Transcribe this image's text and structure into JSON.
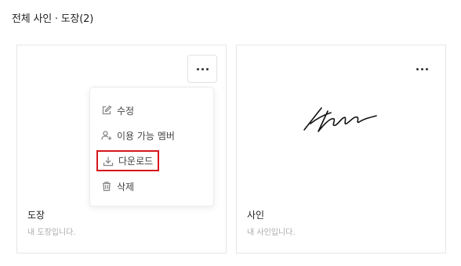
{
  "page": {
    "title": "전체 사인 · 도장(2)"
  },
  "cards": [
    {
      "name": "도장",
      "description": "내 도장입니다."
    },
    {
      "name": "사인",
      "description": "내 사인입니다."
    }
  ],
  "menu": {
    "edit": "수정",
    "members": "이용 가능 멤버",
    "download": "다운로드",
    "delete": "삭제"
  },
  "colors": {
    "highlight": "#d6151c",
    "border": "#e6e6e6"
  }
}
